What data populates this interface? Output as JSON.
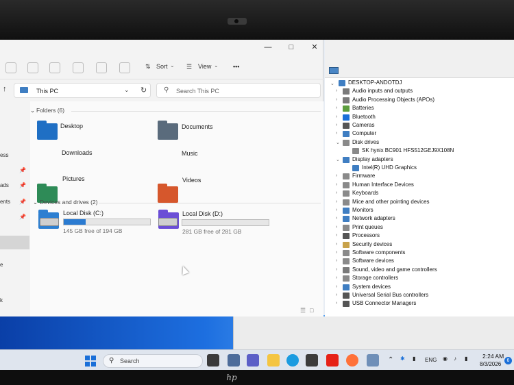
{
  "explorer": {
    "toolbar": {
      "sort_label": "Sort",
      "view_label": "View",
      "more_label": "•••"
    },
    "address": "This PC",
    "search_placeholder": "Search This PC",
    "nav_fragments": [
      "ess",
      "ads",
      "ents",
      "e",
      "k"
    ],
    "folders_header": "Folders (6)",
    "folders": [
      {
        "label": "Desktop",
        "color": "#1f6fc4"
      },
      {
        "label": "Documents",
        "color": "#5a6b7c"
      },
      {
        "label": "Downloads",
        "color": "#2e8b57"
      },
      {
        "label": "Music",
        "color": "#d6572c"
      },
      {
        "label": "Pictures",
        "color": "#2d7fd1"
      },
      {
        "label": "Videos",
        "color": "#6b4ed6"
      }
    ],
    "drives_header": "Devices and drives (2)",
    "drives": [
      {
        "label": "Local Disk (C:)",
        "free": "145 GB free of 194 GB",
        "used_fraction": 0.25
      },
      {
        "label": "Local Disk (D:)",
        "free": "281 GB free of 281 GB",
        "used_fraction": 0.0
      }
    ]
  },
  "device_manager": {
    "root": "DESKTOP-ANDOTDJ",
    "items": [
      {
        "label": "Audio inputs and outputs",
        "state": "collapsed",
        "level": 1,
        "color": "#7a7a7a"
      },
      {
        "label": "Audio Processing Objects (APOs)",
        "state": "collapsed",
        "level": 1,
        "color": "#7a7a7a"
      },
      {
        "label": "Batteries",
        "state": "collapsed",
        "level": 1,
        "color": "#5c9e3e"
      },
      {
        "label": "Bluetooth",
        "state": "collapsed",
        "level": 1,
        "color": "#1a6fd8"
      },
      {
        "label": "Cameras",
        "state": "collapsed",
        "level": 1,
        "color": "#555555"
      },
      {
        "label": "Computer",
        "state": "collapsed",
        "level": 1,
        "color": "#3f7ec2"
      },
      {
        "label": "Disk drives",
        "state": "expanded",
        "level": 1,
        "color": "#8a8a8a"
      },
      {
        "label": "SK hynix BC901 HFS512GEJ9X108N",
        "state": "leaf",
        "level": 2,
        "color": "#8a8a8a"
      },
      {
        "label": "Display adapters",
        "state": "expanded",
        "level": 1,
        "color": "#3f7ec2"
      },
      {
        "label": "Intel(R) UHD Graphics",
        "state": "leaf",
        "level": 2,
        "color": "#3f7ec2"
      },
      {
        "label": "Firmware",
        "state": "collapsed",
        "level": 1,
        "color": "#8a8a8a"
      },
      {
        "label": "Human Interface Devices",
        "state": "collapsed",
        "level": 1,
        "color": "#8a8a8a"
      },
      {
        "label": "Keyboards",
        "state": "collapsed",
        "level": 1,
        "color": "#8a8a8a"
      },
      {
        "label": "Mice and other pointing devices",
        "state": "collapsed",
        "level": 1,
        "color": "#8a8a8a"
      },
      {
        "label": "Monitors",
        "state": "collapsed",
        "level": 1,
        "color": "#3f7ec2"
      },
      {
        "label": "Network adapters",
        "state": "collapsed",
        "level": 1,
        "color": "#3f7ec2"
      },
      {
        "label": "Print queues",
        "state": "collapsed",
        "level": 1,
        "color": "#8a8a8a"
      },
      {
        "label": "Processors",
        "state": "collapsed",
        "level": 1,
        "color": "#555555"
      },
      {
        "label": "Security devices",
        "state": "collapsed",
        "level": 1,
        "color": "#c8a24a"
      },
      {
        "label": "Software components",
        "state": "collapsed",
        "level": 1,
        "color": "#8a8a8a"
      },
      {
        "label": "Software devices",
        "state": "collapsed",
        "level": 1,
        "color": "#8a8a8a"
      },
      {
        "label": "Sound, video and game controllers",
        "state": "collapsed",
        "level": 1,
        "color": "#7a7a7a"
      },
      {
        "label": "Storage controllers",
        "state": "collapsed",
        "level": 1,
        "color": "#8a8a8a"
      },
      {
        "label": "System devices",
        "state": "collapsed",
        "level": 1,
        "color": "#3f7ec2"
      },
      {
        "label": "Universal Serial Bus controllers",
        "state": "collapsed",
        "level": 1,
        "color": "#555555"
      },
      {
        "label": "USB Connector Managers",
        "state": "collapsed",
        "level": 1,
        "color": "#555555"
      }
    ]
  },
  "taskbar": {
    "search_label": "Search",
    "language": "ENG",
    "time": "2:24 AM",
    "date": "8/3/2026",
    "notification_count": "6"
  }
}
